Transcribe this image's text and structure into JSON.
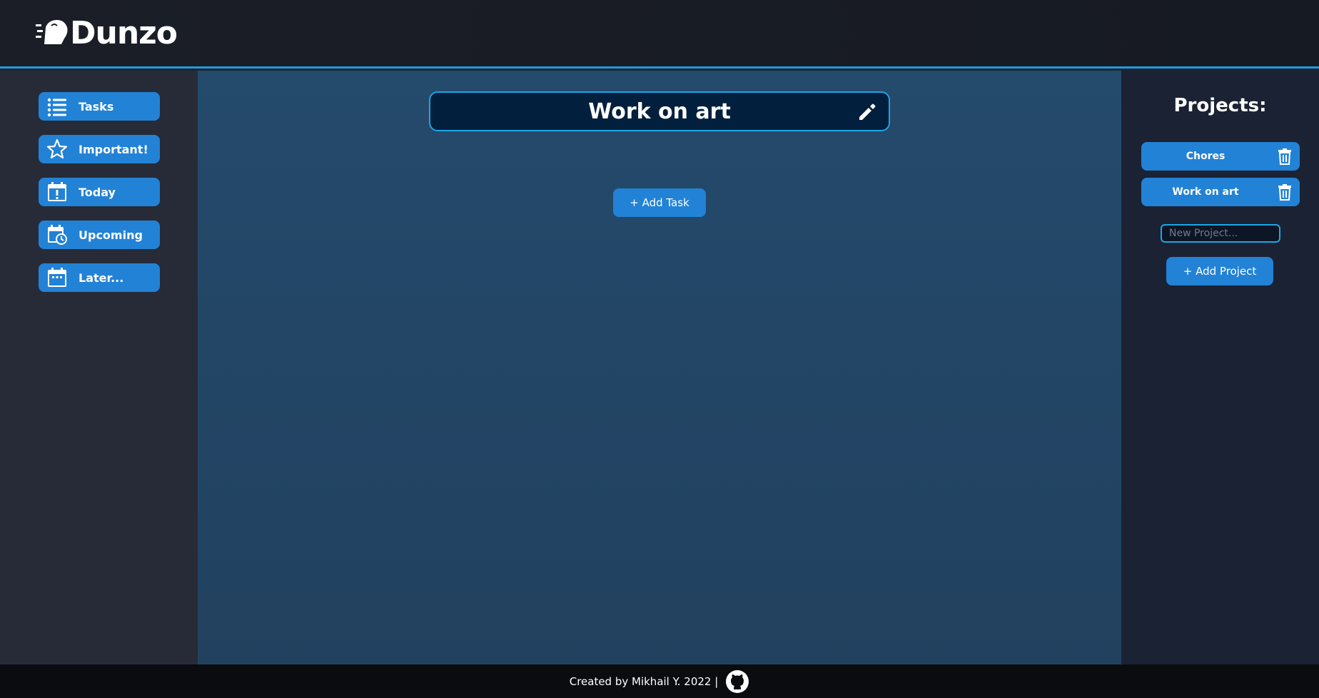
{
  "app": {
    "logo_text": "Dunzo",
    "logo_icon": "rocket-horse-icon"
  },
  "sidebar": {
    "items": [
      {
        "label": "Tasks",
        "icon": "list-icon"
      },
      {
        "label": "Important!",
        "icon": "star-icon"
      },
      {
        "label": "Today",
        "icon": "calendar-exclamation-icon"
      },
      {
        "label": "Upcoming",
        "icon": "calendar-clock-icon"
      },
      {
        "label": "Later...",
        "icon": "calendar-icon"
      }
    ]
  },
  "main": {
    "project_title": "Work on art",
    "edit_icon": "pencil-icon",
    "add_task_label": "+ Add Task"
  },
  "projects": {
    "title": "Projects:",
    "items": [
      {
        "name": "Chores",
        "icon": "trash-icon"
      },
      {
        "name": "Work on art",
        "icon": "trash-icon"
      }
    ],
    "new_project_placeholder": "New Project...",
    "add_project_label": "+ Add Project"
  },
  "footer": {
    "credit": "Created by Mikhail Y. 2022 |",
    "link_icon": "github-icon"
  },
  "colors": {
    "accent": "#2282d6",
    "border_accent": "#1aa6e8",
    "header_bg": "#1b1e26",
    "sidebar_bg": "#262b37",
    "main_bg": "#244a6c",
    "projects_bg": "#1a2234",
    "footer_bg": "#0b0c10"
  }
}
